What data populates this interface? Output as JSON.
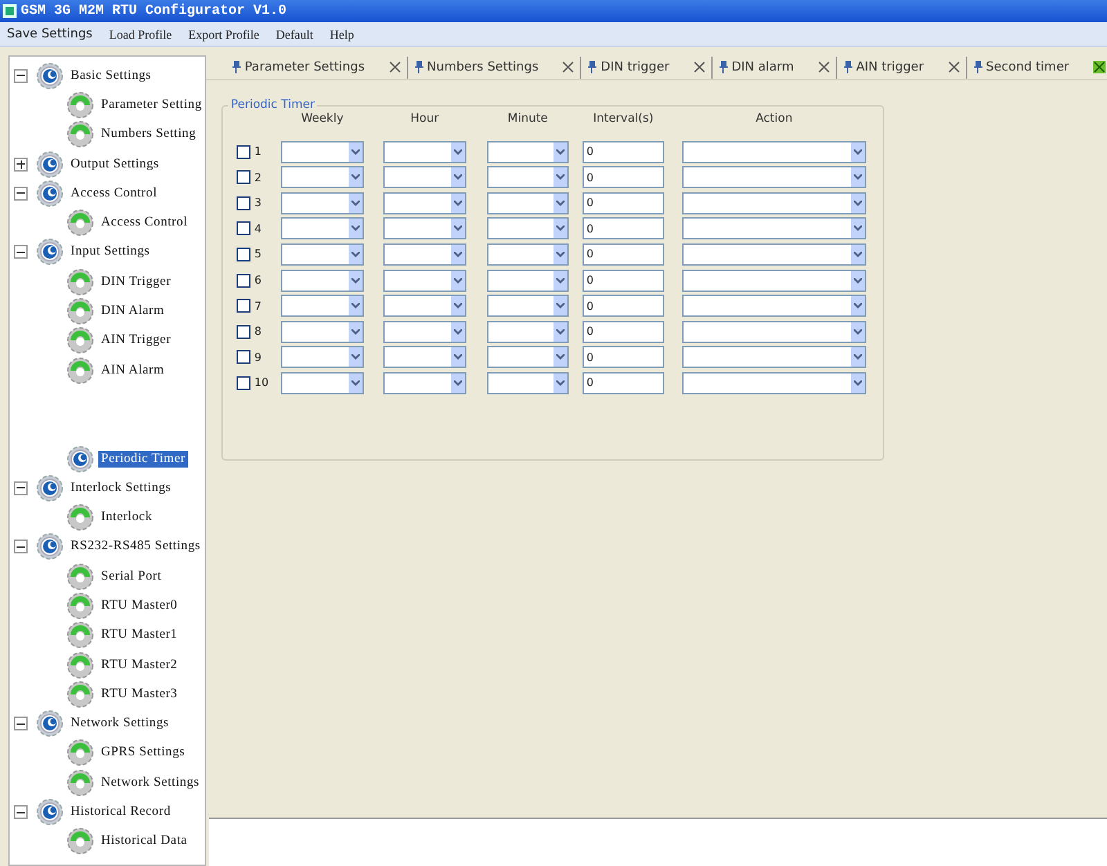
{
  "window": {
    "title": "GSM 3G M2M RTU Configurator V1.0"
  },
  "menu": [
    "Save Settings",
    "Load Profile",
    "Export Profile",
    "Default",
    "Help"
  ],
  "tree": [
    {
      "label": "Basic Settings",
      "kind": "group",
      "expanded": true,
      "children": [
        {
          "label": "Parameter Setting",
          "kind": "page",
          "selected": false
        },
        {
          "label": "Numbers Setting",
          "kind": "page",
          "selected": false
        }
      ]
    },
    {
      "label": "Output Settings",
      "kind": "group",
      "expanded": false
    },
    {
      "label": "Access Control",
      "kind": "group",
      "expanded": true,
      "children": [
        {
          "label": "Access Control",
          "kind": "page",
          "selected": false
        }
      ]
    },
    {
      "label": "Input Settings",
      "kind": "group",
      "expanded": true,
      "children": [
        {
          "label": "DIN Trigger",
          "kind": "page",
          "selected": false
        },
        {
          "label": "DIN Alarm",
          "kind": "page",
          "selected": false
        },
        {
          "label": "AIN Trigger",
          "kind": "page",
          "selected": false
        },
        {
          "label": "AIN Alarm",
          "kind": "page",
          "selected": false
        },
        {
          "kind": "hidden"
        },
        {
          "kind": "hidden"
        },
        {
          "label": "Periodic Timer",
          "kind": "current",
          "selected": true
        }
      ]
    },
    {
      "label": "Interlock Settings",
      "kind": "group",
      "expanded": true,
      "children": [
        {
          "label": "Interlock",
          "kind": "page",
          "selected": false
        }
      ]
    },
    {
      "label": "RS232-RS485 Settings",
      "kind": "group",
      "expanded": true,
      "children": [
        {
          "label": "Serial Port",
          "kind": "page",
          "selected": false
        },
        {
          "label": "RTU Master0",
          "kind": "page",
          "selected": false
        },
        {
          "label": "RTU Master1",
          "kind": "page",
          "selected": false
        },
        {
          "label": "RTU Master2",
          "kind": "page",
          "selected": false
        },
        {
          "label": "RTU Master3",
          "kind": "page",
          "selected": false
        }
      ]
    },
    {
      "label": "Network Settings",
      "kind": "group",
      "expanded": true,
      "children": [
        {
          "label": "GPRS Settings",
          "kind": "page",
          "selected": false
        },
        {
          "label": "Network Settings",
          "kind": "page",
          "selected": false
        }
      ]
    },
    {
      "label": "Historical Record",
      "kind": "group",
      "expanded": true,
      "children": [
        {
          "label": "Historical Data",
          "kind": "page",
          "selected": false
        }
      ]
    }
  ],
  "tabs": [
    {
      "label": "Parameter Settings",
      "selected": false
    },
    {
      "label": "Numbers Settings",
      "selected": false
    },
    {
      "label": "DIN trigger",
      "selected": false
    },
    {
      "label": "DIN alarm",
      "selected": false
    },
    {
      "label": "AIN trigger",
      "selected": false
    },
    {
      "label": "Second timer",
      "selected": true
    }
  ],
  "group": {
    "title": "Periodic Timer",
    "columns": [
      "Weekly",
      "Hour",
      "Minute",
      "Interval(s)",
      "Action"
    ],
    "rows": [
      {
        "number": "1",
        "checked": false,
        "interval": "0"
      },
      {
        "number": "2",
        "checked": false,
        "interval": "0"
      },
      {
        "number": "3",
        "checked": false,
        "interval": "0"
      },
      {
        "number": "4",
        "checked": false,
        "interval": "0"
      },
      {
        "number": "5",
        "checked": false,
        "interval": "0"
      },
      {
        "number": "6",
        "checked": false,
        "interval": "0"
      },
      {
        "number": "7",
        "checked": false,
        "interval": "0"
      },
      {
        "number": "8",
        "checked": false,
        "interval": "0"
      },
      {
        "number": "9",
        "checked": false,
        "interval": "0"
      },
      {
        "number": "10",
        "checked": false,
        "interval": "0"
      }
    ]
  }
}
